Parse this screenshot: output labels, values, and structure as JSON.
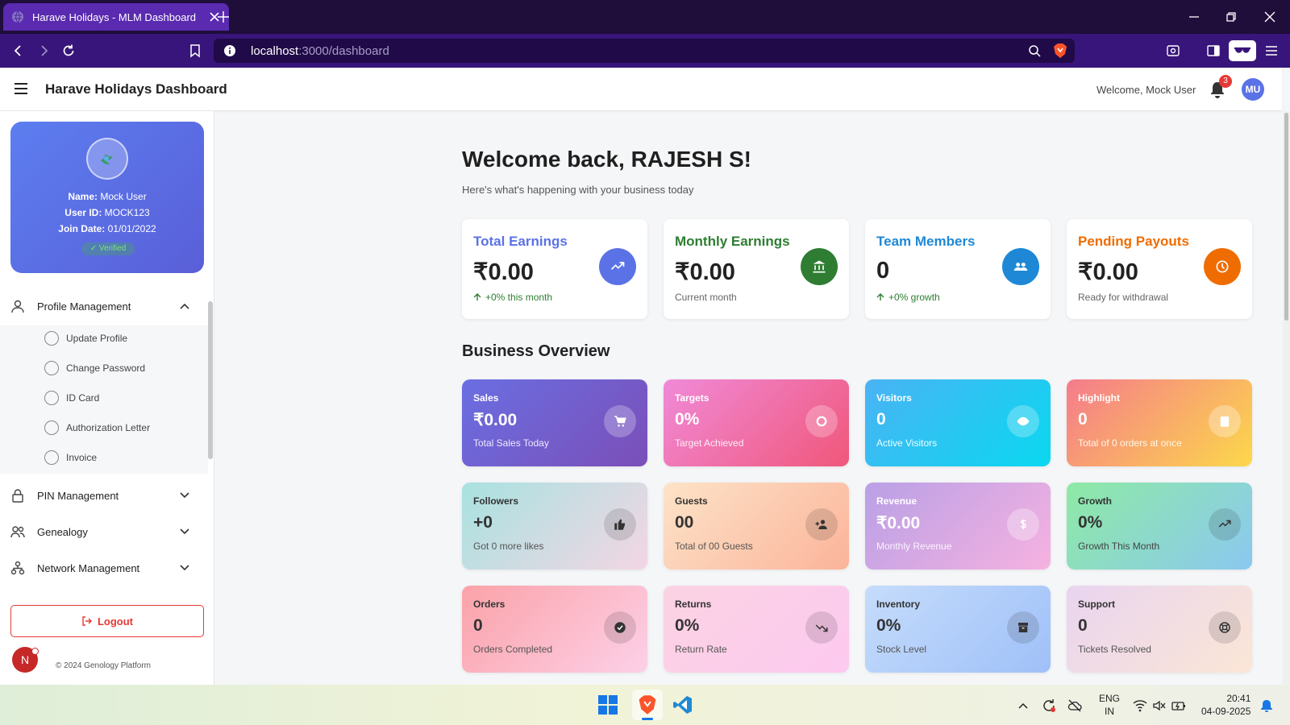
{
  "browser": {
    "tab_title": "Harave Holidays - MLM Dashboard",
    "url_host": "localhost",
    "url_path": ":3000/dashboard"
  },
  "header": {
    "title": "Harave Holidays Dashboard",
    "welcome": "Welcome, Mock User",
    "notification_count": "3",
    "avatar_initials": "MU"
  },
  "profile": {
    "name_label": "Name:",
    "name": "Mock User",
    "userid_label": "User ID:",
    "userid": "MOCK123",
    "join_label": "Join Date:",
    "join_date": "01/01/2022",
    "verified": "✓ Verified"
  },
  "sidebar": {
    "profile_management": "Profile Management",
    "sub_items": [
      "Update Profile",
      "Change Password",
      "ID Card",
      "Authorization Letter",
      "Invoice"
    ],
    "pin_management": "PIN Management",
    "genealogy": "Genealogy",
    "network_management": "Network Management",
    "logout": "Logout",
    "footer": "© 2024 Genology Platform",
    "avatar_letter": "N"
  },
  "main": {
    "greeting": "Welcome back, RAJESH S!",
    "subtitle": "Here's what's happening with your business today",
    "overview_title": "Business Overview",
    "stat_cards": [
      {
        "title": "Total Earnings",
        "value": "₹0.00",
        "sub": "+0% this month",
        "color": "#5b72e6",
        "icon": "trending-up-icon"
      },
      {
        "title": "Monthly Earnings",
        "value": "₹0.00",
        "sub": "Current month",
        "color": "#2e7d32",
        "icon": "bank-icon"
      },
      {
        "title": "Team Members",
        "value": "0",
        "sub": "+0% growth",
        "color": "#1e88d6",
        "icon": "group-icon"
      },
      {
        "title": "Pending Payouts",
        "value": "₹0.00",
        "sub": "Ready for withdrawal",
        "color": "#ef6c00",
        "icon": "clock-icon"
      }
    ],
    "tiles": [
      {
        "label": "Sales",
        "value": "₹0.00",
        "sub": "Total Sales Today",
        "icon": "cart-icon"
      },
      {
        "label": "Targets",
        "value": "0%",
        "sub": "Target Achieved",
        "icon": "target-icon"
      },
      {
        "label": "Visitors",
        "value": "0",
        "sub": "Active Visitors",
        "icon": "eye-icon"
      },
      {
        "label": "Highlight",
        "value": "0",
        "sub": "Total of 0 orders at once",
        "icon": "clipboard-icon"
      },
      {
        "label": "Followers",
        "value": "+0",
        "sub": "Got 0 more likes",
        "icon": "thumbs-up-icon"
      },
      {
        "label": "Guests",
        "value": "00",
        "sub": "Total of 00 Guests",
        "icon": "person-add-icon"
      },
      {
        "label": "Revenue",
        "value": "₹0.00",
        "sub": "Monthly Revenue",
        "icon": "dollar-icon"
      },
      {
        "label": "Growth",
        "value": "0%",
        "sub": "Growth This Month",
        "icon": "trending-up-icon"
      },
      {
        "label": "Orders",
        "value": "0",
        "sub": "Orders Completed",
        "icon": "check-circle-icon"
      },
      {
        "label": "Returns",
        "value": "0%",
        "sub": "Return Rate",
        "icon": "trending-down-icon"
      },
      {
        "label": "Inventory",
        "value": "0%",
        "sub": "Stock Level",
        "icon": "archive-icon"
      },
      {
        "label": "Support",
        "value": "0",
        "sub": "Tickets Resolved",
        "icon": "lifebuoy-icon"
      }
    ]
  },
  "taskbar": {
    "lang_top": "ENG",
    "lang_bottom": "IN",
    "time": "20:41",
    "date": "04-09-2025"
  }
}
